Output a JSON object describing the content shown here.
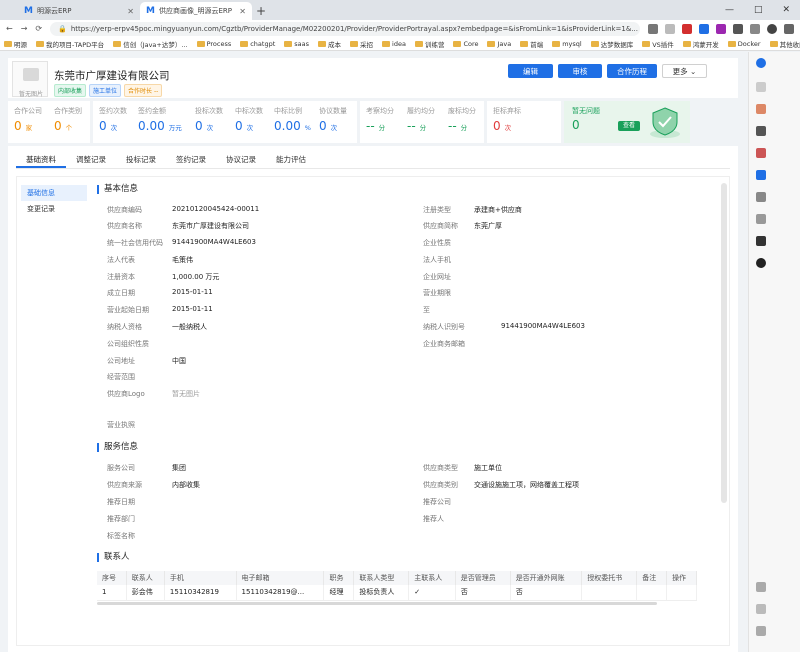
{
  "browser": {
    "tabs": [
      {
        "title": "明源云ERP"
      },
      {
        "title": "供应商画像_明源云ERP"
      }
    ],
    "new_tab": "+",
    "window_controls": [
      "—",
      "□",
      "✕"
    ],
    "url": "https://yerp-erpv45poc.mingyuanyun.com/Cgztb/ProviderManage/M02200201/Provider/ProviderPortrayal.aspx?embedpage=&isFromLink=1&isProviderLink=1&...",
    "bookmarks": [
      "明源",
      "我的项目-TAPD平台",
      "信创（Java+达梦）...",
      "Process",
      "chatgpt",
      "saas",
      "成本",
      "采招",
      "idea",
      "训练营",
      "Core",
      "Java",
      "前端",
      "mysql",
      "达梦数据库",
      "VS插件",
      "鸿蒙开发",
      "Docker"
    ],
    "other_bookmarks": "其他收藏夹"
  },
  "header": {
    "avatar_caption": "暂无图片",
    "company_name": "东莞市广厚建设有限公司",
    "tags": [
      "内部收集",
      "施工单位",
      "合作时长 --"
    ],
    "buttons": {
      "edit": "编辑",
      "audit": "审核",
      "coop": "合作历程",
      "more": "更多"
    }
  },
  "stats": {
    "coop_company": {
      "label": "合作公司",
      "value": "0",
      "unit": "家"
    },
    "coop_category": {
      "label": "合作类别",
      "value": "0",
      "unit": "个"
    },
    "sign_count": {
      "label": "签约次数",
      "value": "0",
      "unit": "次"
    },
    "sign_amount": {
      "label": "签约金额",
      "value": "0.00",
      "unit": "万元"
    },
    "bid_count": {
      "label": "投标次数",
      "value": "0",
      "unit": "次"
    },
    "win_count": {
      "label": "中标次数",
      "value": "0",
      "unit": "次"
    },
    "win_ratio": {
      "label": "中标比例",
      "value": "0.00",
      "unit": "%"
    },
    "agreement_count": {
      "label": "协议数量",
      "value": "0",
      "unit": "次"
    },
    "inspect_avg": {
      "label": "考察均分",
      "value": "--",
      "unit": "分"
    },
    "perform_avg": {
      "label": "履约均分",
      "value": "--",
      "unit": "分"
    },
    "exit_avg": {
      "label": "废标均分",
      "value": "--",
      "unit": "分"
    },
    "reject_count": {
      "label": "拒标弃标",
      "value": "0",
      "unit": "次"
    },
    "risk": {
      "label": "暂无问题",
      "value": "0",
      "button": "查看"
    }
  },
  "tabs": [
    "基础资料",
    "调整记录",
    "投标记录",
    "签约记录",
    "协议记录",
    "能力评估"
  ],
  "left_nav": [
    "基础信息",
    "变更记录"
  ],
  "basic": {
    "title": "基本信息",
    "left": [
      {
        "label": "供应商编码",
        "value": "20210120045424-00011"
      },
      {
        "label": "供应商名称",
        "value": "东莞市广厚建设有限公司"
      },
      {
        "label": "统一社会信用代码",
        "value": "91441900MA4W4LE603"
      },
      {
        "label": "法人代表",
        "value": "毛策伟"
      },
      {
        "label": "注册资本",
        "value": "1,000.00 万元"
      },
      {
        "label": "成立日期",
        "value": "2015-01-11"
      },
      {
        "label": "营业起始日期",
        "value": "2015-01-11"
      },
      {
        "label": "纳税人资格",
        "value": "一般纳税人"
      },
      {
        "label": "公司组织性质",
        "value": ""
      },
      {
        "label": "公司地址",
        "value": "中国"
      },
      {
        "label": "经营范围",
        "value": ""
      },
      {
        "label": "供应商Logo",
        "value": "暂无图片"
      }
    ],
    "right": [
      {
        "label": "注册类型",
        "value": "承建商+供应商"
      },
      {
        "label": "供应商简称",
        "value": "东莞广厚"
      },
      {
        "label": "企业性质",
        "value": ""
      },
      {
        "label": "法人手机",
        "value": ""
      },
      {
        "label": "企业网址",
        "value": ""
      },
      {
        "label": "营业期限",
        "value": ""
      },
      {
        "label": "至",
        "value": ""
      },
      {
        "label": "纳税人识别号",
        "value": "91441900MA4W4LE603"
      },
      {
        "label": "企业商务邮箱",
        "value": ""
      }
    ],
    "license_label": "营业执照"
  },
  "service": {
    "title": "服务信息",
    "left": [
      {
        "label": "服务公司",
        "value": "集团"
      },
      {
        "label": "供应商来源",
        "value": "内部收集"
      },
      {
        "label": "推荐日期",
        "value": ""
      },
      {
        "label": "推荐部门",
        "value": ""
      },
      {
        "label": "标签名称",
        "value": ""
      }
    ],
    "right": [
      {
        "label": "供应商类型",
        "value": "施工单位"
      },
      {
        "label": "供应商类别",
        "value": "交通设施施工项，网络覆盖工程项"
      },
      {
        "label": "推荐公司",
        "value": ""
      },
      {
        "label": "推荐人",
        "value": ""
      }
    ]
  },
  "contacts": {
    "title": "联系人",
    "columns": [
      "序号",
      "联系人",
      "手机",
      "电子邮箱",
      "职务",
      "联系人类型",
      "主联系人",
      "是否管理员",
      "是否开通外网账",
      "授权委托书",
      "备注",
      "操作"
    ],
    "rows": [
      [
        "1",
        "彭会伟",
        "15110342819",
        "15110342819@...",
        "经理",
        "投标负责人",
        "✓",
        "否",
        "否",
        "",
        "",
        ""
      ]
    ]
  }
}
